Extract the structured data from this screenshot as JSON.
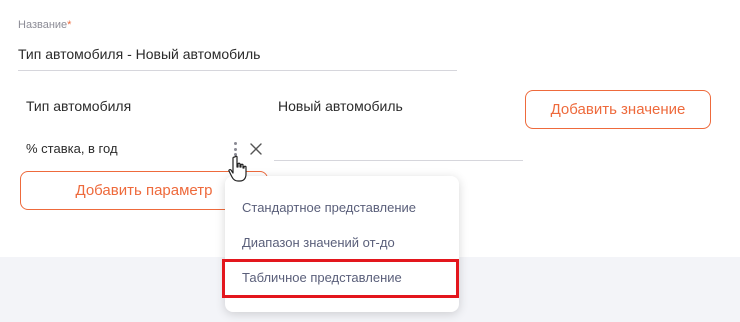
{
  "name_field": {
    "label": "Название",
    "required_mark": "*",
    "value": "Тип автомобиля - Новый автомобиль"
  },
  "columns": {
    "param_header": "Тип автомобиля",
    "value_header": "Новый автомобиль"
  },
  "buttons": {
    "add_value": "Добавить значение",
    "add_param": "Добавить параметр"
  },
  "parameter_row": {
    "name": "% ставка, в год",
    "menu_icon": "kebab-vertical-icon",
    "remove_icon": "close-icon"
  },
  "dropdown": {
    "items": [
      "Стандартное представление",
      "Диапазон значений от-до",
      "Табличное представление"
    ],
    "highlighted_index": 2
  },
  "colors": {
    "accent": "#ee6a3c",
    "highlight_border": "#e3161d",
    "menu_text": "#5a5f7a",
    "page_bg": "#f3f4f8"
  }
}
